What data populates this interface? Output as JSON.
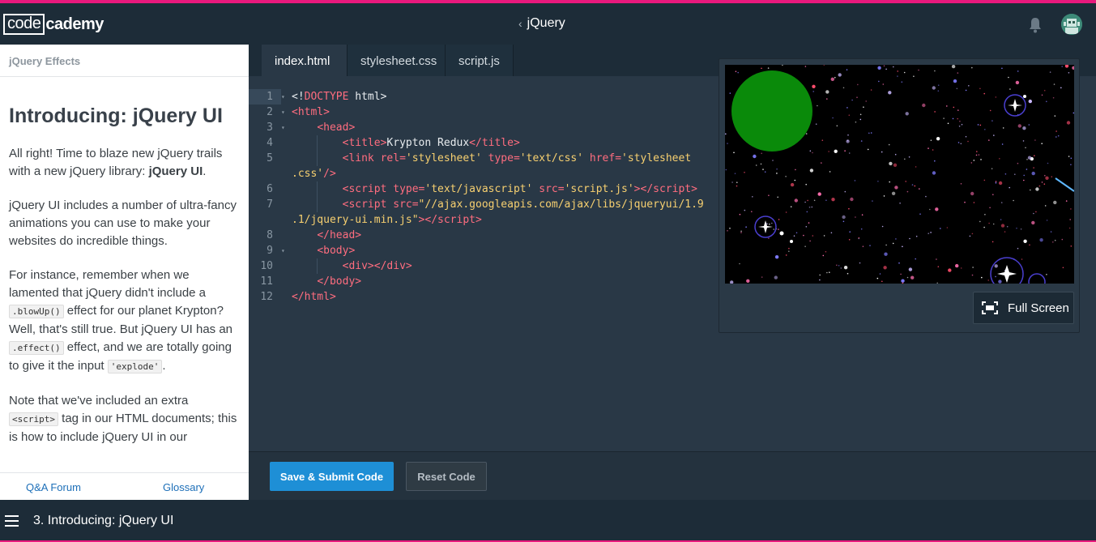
{
  "header": {
    "logo_box": "code",
    "logo_rest": "cademy",
    "course_title": "jQuery",
    "bell_icon": "bell-icon",
    "avatar_icon": "user-avatar-icon"
  },
  "lesson": {
    "breadcrumb": "jQuery Effects",
    "title": "Introducing: jQuery UI",
    "p1_a": "All right! Time to blaze new jQuery trails with a new jQuery library: ",
    "p1_b": "jQuery UI",
    "p1_c": ".",
    "p2": "jQuery UI includes a number of ultra-fancy animations you can use to make your websites do incredible things.",
    "p3_a": "For instance, remember when we lamented that jQuery didn't include a ",
    "p3_code1": ".blowUp()",
    "p3_b": " effect for our planet Krypton? Well, that's still true. But jQuery UI has an ",
    "p3_code2": ".effect()",
    "p3_c": " effect, and we are totally going to give it the input ",
    "p3_code3": "'explode'",
    "p3_d": ".",
    "p4_a": "Note that we've included an extra ",
    "p4_code": "<script>",
    "p4_b": " tag in our HTML documents; this is how to include jQuery UI in our",
    "footer_qa": "Q&A Forum",
    "footer_glossary": "Glossary"
  },
  "editor": {
    "tabs": [
      "index.html",
      "stylesheet.css",
      "script.js"
    ],
    "active_tab": "index.html",
    "current_line": 1
  },
  "preview": {
    "fullscreen_label": "Full Screen",
    "planet_color": "#0a8a0a"
  },
  "actions": {
    "save_label": "Save & Submit Code",
    "reset_label": "Reset Code"
  },
  "bottom": {
    "lesson_label": "3. Introducing: jQuery UI"
  },
  "colors": {
    "accent": "#e8197d",
    "primary_button": "#1e8fd6",
    "header_bg": "#1d2c38",
    "editor_bg": "#293846"
  }
}
